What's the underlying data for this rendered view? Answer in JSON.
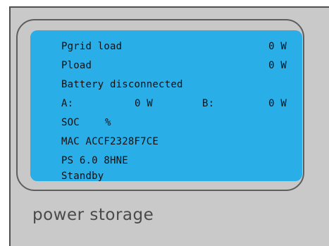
{
  "display": {
    "rows": [
      {
        "left": "Pgrid load",
        "right": "0 W"
      },
      {
        "left": "Pload",
        "right": "0 W"
      },
      {
        "left": "Battery disconnected"
      },
      {
        "a_label": "A:",
        "a_value": "0 W",
        "b_label": "B:",
        "b_value": "0 W"
      },
      {
        "soc_label": "SOC",
        "soc_unit": "%"
      },
      {
        "left": "MAC ACCF2328F7CE"
      },
      {
        "left": "PS 6.0 8HNE"
      },
      {
        "left": "Standby"
      }
    ]
  },
  "device": {
    "label": "power storage"
  },
  "colors": {
    "lcd_background": "#2aaee8",
    "device_body": "#c9c9c9"
  }
}
